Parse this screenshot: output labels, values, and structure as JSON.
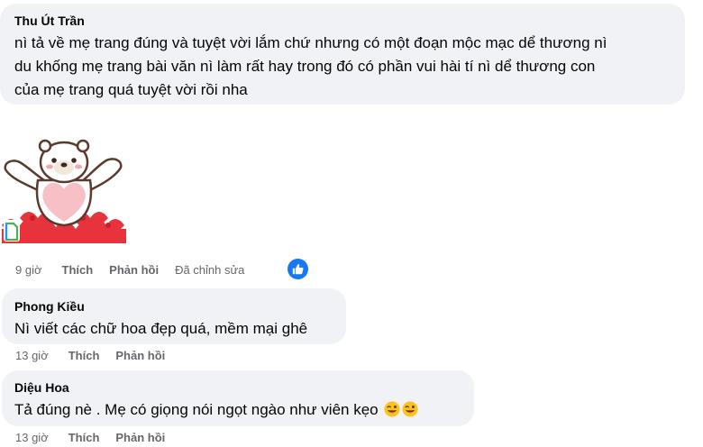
{
  "comments": [
    {
      "author": "Thu Út Trần",
      "lines": [
        "nì tả về mẹ trang đúng và tuyệt vời lắm chứ nhưng có một đoạn mộc mạc dể thương nì",
        "du khống mẹ trang bài văn nì làm rất hay trong đó có phần vui hài tí nì dể thương con",
        "của mẹ trang quá tuyệt vời rồi nha"
      ],
      "sticker": "polar-bear-hug-hearts-sticker",
      "time": "9 giờ",
      "like_label": "Thích",
      "reply_label": "Phản hồi",
      "edited_label": "Đã chỉnh sửa",
      "reaction_icon": "like-thumb-icon"
    },
    {
      "author": "Phong Kiều",
      "lines": [
        "Nì viết các chữ hoa đẹp quá, mềm mại ghê"
      ],
      "time": "13 giờ",
      "like_label": "Thích",
      "reply_label": "Phản hồi"
    },
    {
      "author": "Diệu Hoa",
      "lines": [
        "Tả đúng nè . Mẹ có giọng nói ngọt ngào như viên kẹo"
      ],
      "emojis": [
        "tongue-wink-emoji",
        "tongue-wink-emoji"
      ],
      "time": "13 giờ",
      "like_label": "Thích",
      "reply_label": "Phản hồi"
    }
  ],
  "colors": {
    "bubble": "#f0f2f5",
    "text": "#050505",
    "meta": "#65676b",
    "like_blue": "#1877f2"
  }
}
